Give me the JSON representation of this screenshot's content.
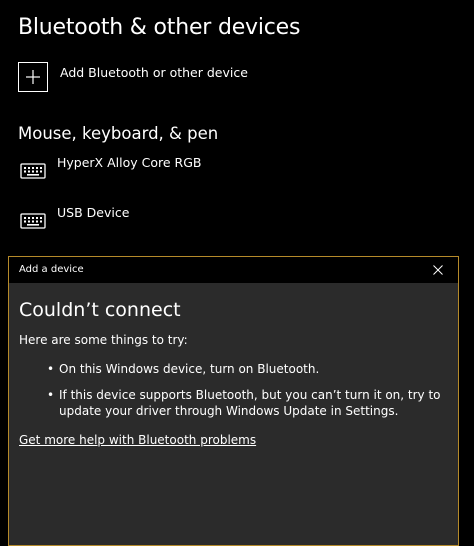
{
  "settings": {
    "title": "Bluetooth & other devices",
    "add_device": {
      "label": "Add Bluetooth or other device",
      "icon": "plus-icon"
    },
    "section_title": "Mouse, keyboard, & pen",
    "devices": [
      {
        "name": "HyperX Alloy Core RGB",
        "icon": "keyboard-icon"
      },
      {
        "name": "USB Device",
        "icon": "keyboard-icon"
      }
    ]
  },
  "dialog": {
    "title": "Add a device",
    "close_icon": "close-icon",
    "heading": "Couldn’t connect",
    "intro": "Here are some things to try:",
    "tips": [
      "On this Windows device, turn on Bluetooth.",
      "If this device supports Bluetooth, but you can’t turn it on, try to update your driver through Windows Update in Settings."
    ],
    "bullet": "•",
    "help_link": "Get more help with Bluetooth problems",
    "accent_color": "#b58a2a"
  }
}
